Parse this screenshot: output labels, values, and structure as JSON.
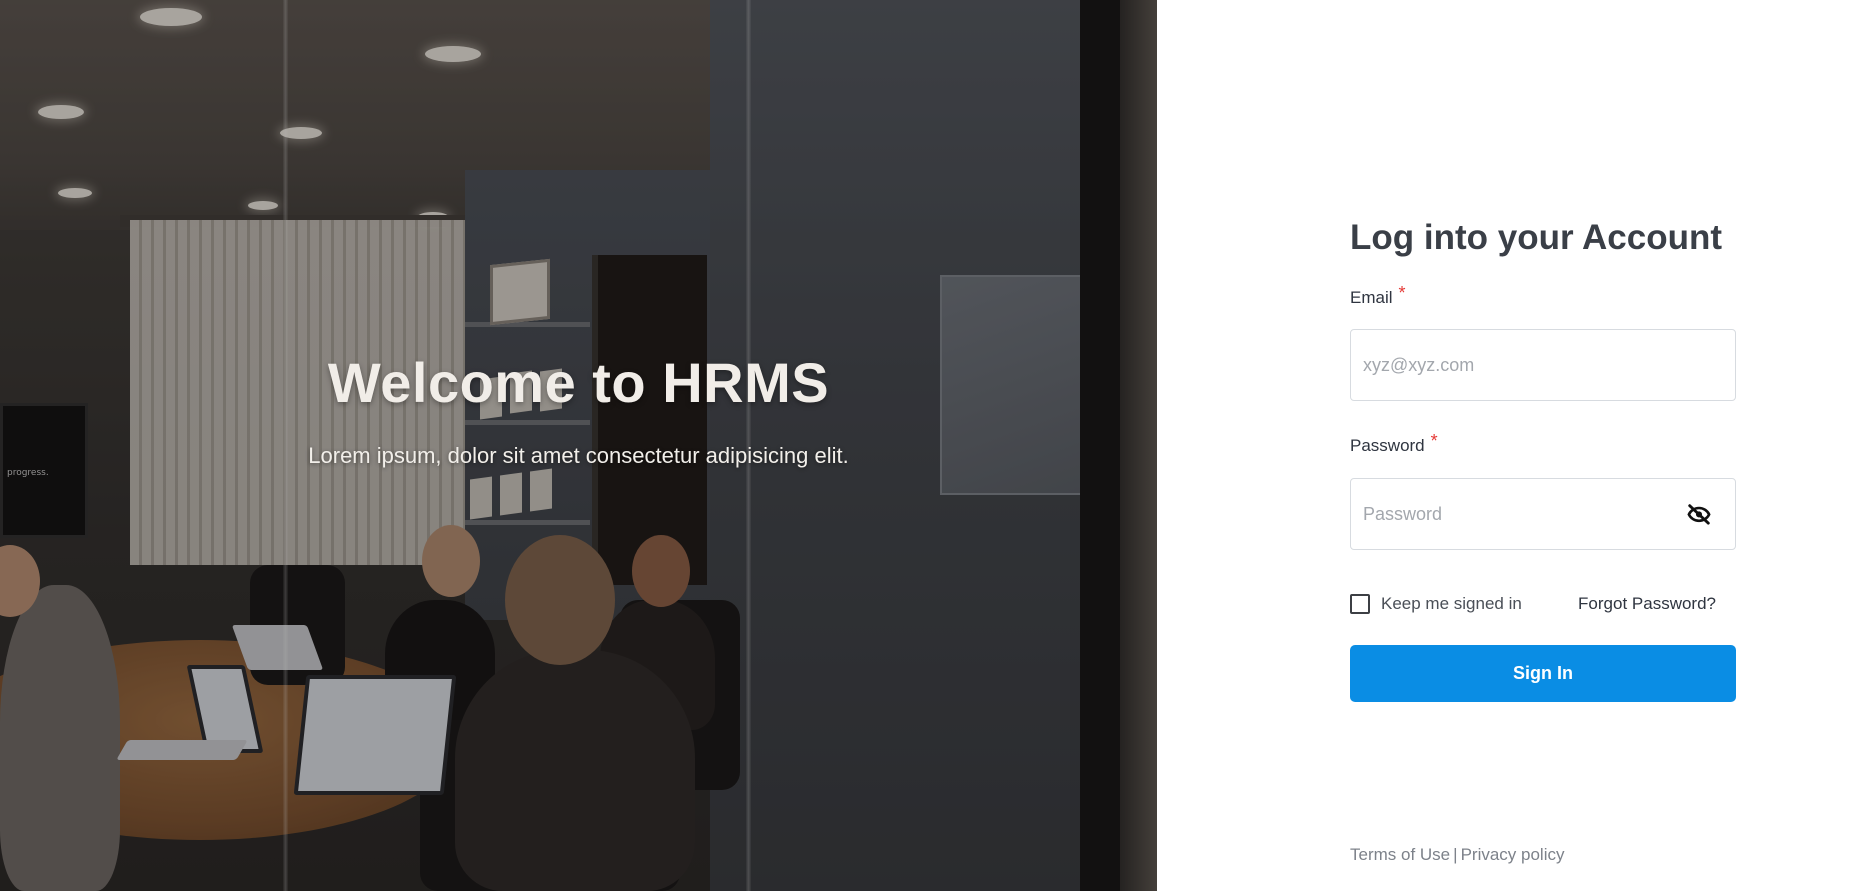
{
  "hero": {
    "title": "Welcome to HRMS",
    "subtitle": "Lorem ipsum, dolor sit amet consectetur adipisicing elit.",
    "monitor_text": "progress."
  },
  "login": {
    "title": "Log into your Account",
    "email_label": "Email",
    "email_placeholder": "xyz@xyz.com",
    "email_value": "",
    "password_label": "Password",
    "password_placeholder": "Password",
    "password_value": "",
    "required_marker": "*",
    "password_visibility_icon": "eye-off-icon",
    "remember_label": "Keep me signed in",
    "remember_checked": false,
    "forgot_label": "Forgot Password?",
    "submit_label": "Sign In"
  },
  "footer": {
    "terms": "Terms of Use",
    "separator": "|",
    "privacy": "Privacy policy"
  },
  "colors": {
    "primary": "#0a8de4",
    "required": "#e53935",
    "title_text": "#3a3f47",
    "muted_text": "#7d828a"
  }
}
